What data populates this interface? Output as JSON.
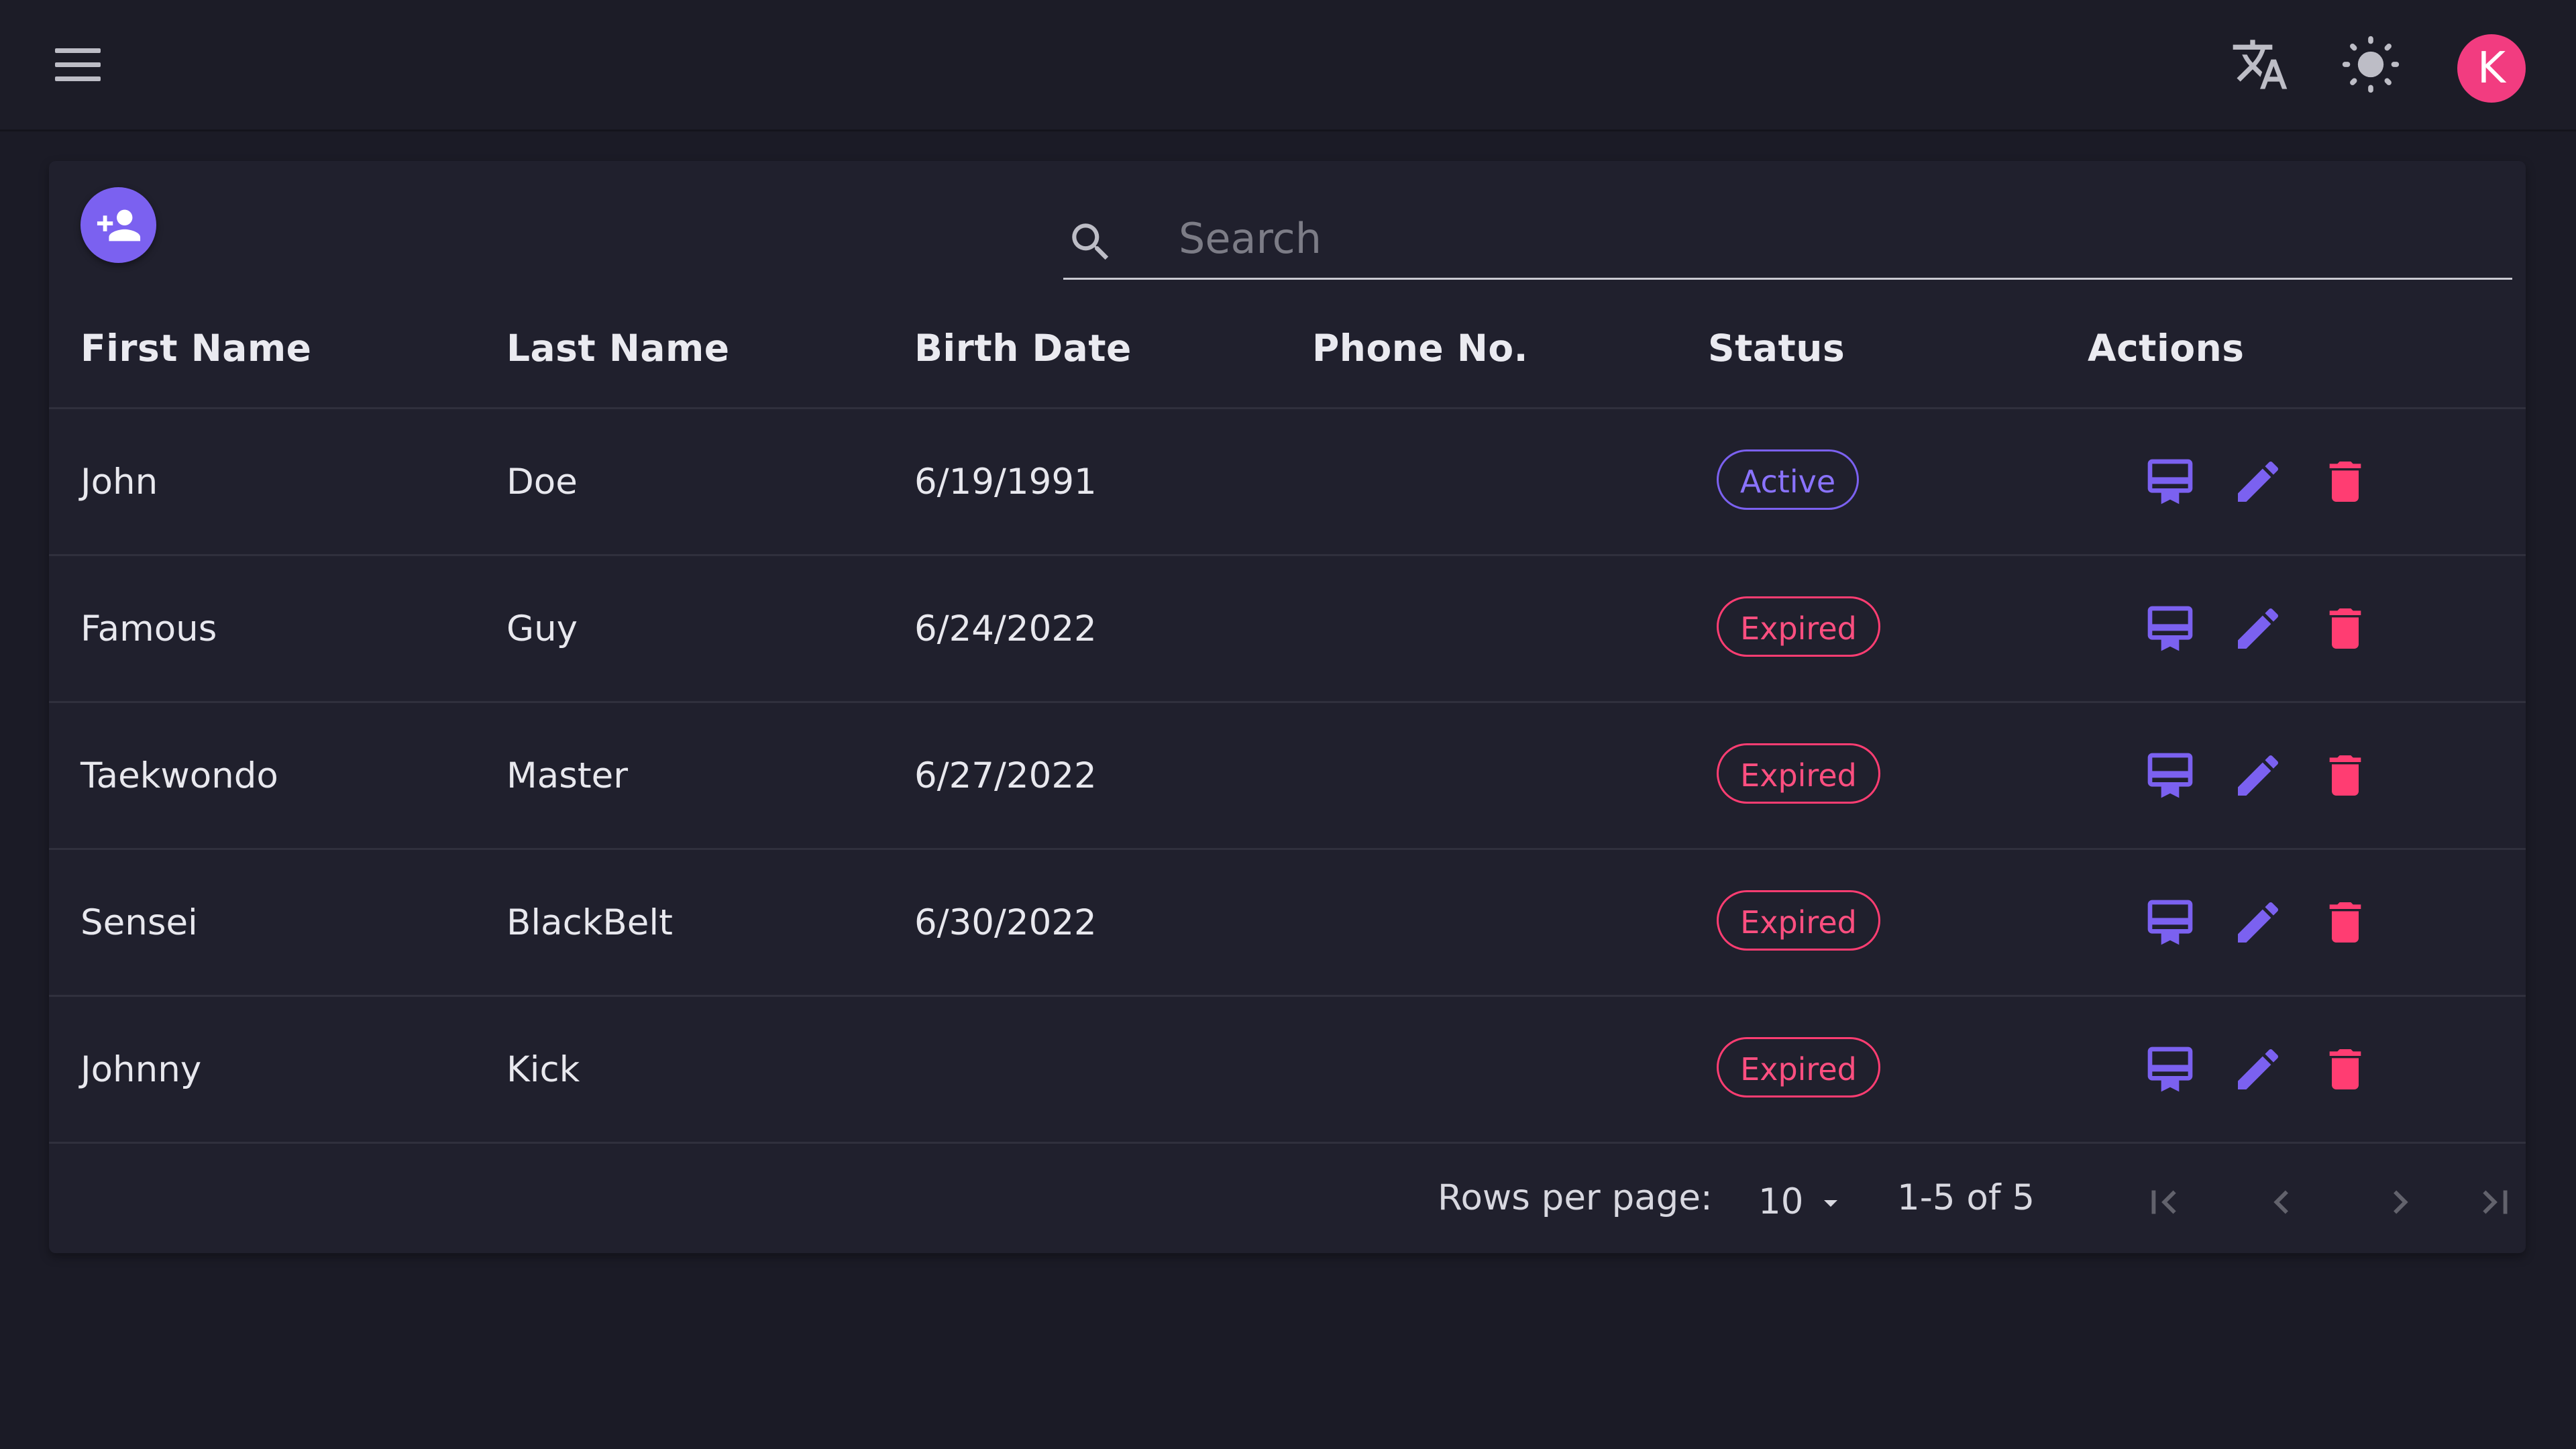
{
  "header": {
    "menu_icon": "hamburger-menu-icon",
    "translate_icon": "translate-icon",
    "theme_icon": "brightness-icon",
    "avatar_letter": "K"
  },
  "colors": {
    "accent": "#7b61f0",
    "danger": "#ff3d72",
    "avatar": "#f23c80",
    "background": "#1b1b26",
    "card": "#20202d"
  },
  "toolbar": {
    "add_icon": "person-add-icon",
    "search_icon": "search-icon",
    "search_placeholder": "Search",
    "search_value": ""
  },
  "table": {
    "columns": [
      "First Name",
      "Last Name",
      "Birth Date",
      "Phone No.",
      "Status",
      "Actions"
    ],
    "rows": [
      {
        "first": "John",
        "last": "Doe",
        "birth": "6/19/1991",
        "phone": "",
        "status": "Active"
      },
      {
        "first": "Famous",
        "last": "Guy",
        "birth": "6/24/2022",
        "phone": "",
        "status": "Expired"
      },
      {
        "first": "Taekwondo",
        "last": "Master",
        "birth": "6/27/2022",
        "phone": "",
        "status": "Expired"
      },
      {
        "first": "Sensei",
        "last": "BlackBelt",
        "birth": "6/30/2022",
        "phone": "",
        "status": "Expired"
      },
      {
        "first": "Johnny",
        "last": "Kick",
        "birth": "",
        "phone": "",
        "status": "Expired"
      }
    ],
    "action_icons": [
      "card-membership-icon",
      "edit-pencil-icon",
      "delete-trash-icon"
    ]
  },
  "pagination": {
    "rows_per_page_label": "Rows per page:",
    "rows_per_page_value": "10",
    "range_text": "1-5 of 5",
    "icons": [
      "first-page-icon",
      "previous-page-icon",
      "next-page-icon",
      "last-page-icon"
    ]
  }
}
